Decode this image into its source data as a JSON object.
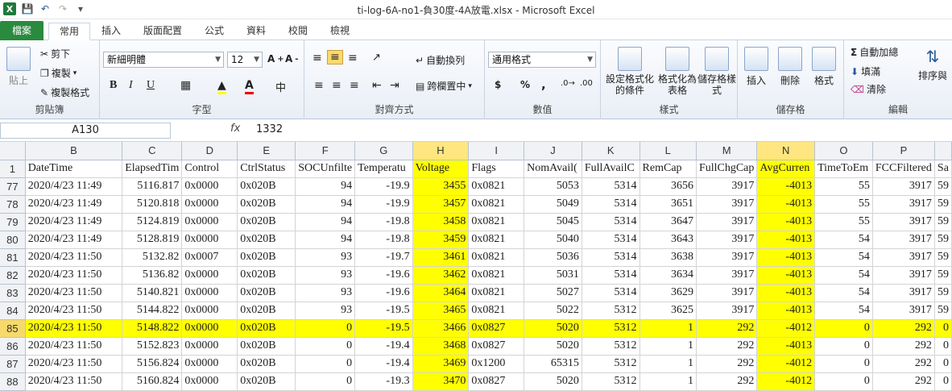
{
  "window": {
    "title": "ti-log-6A-no1-負30度-4A放電.xlsx - Microsoft Excel"
  },
  "tabs": [
    "檔案",
    "常用",
    "插入",
    "版面配置",
    "公式",
    "資料",
    "校閱",
    "檢視"
  ],
  "ribbon": {
    "clipboard": {
      "paste": "貼上",
      "cut": "剪下",
      "copy": "複製",
      "format_painter": "複製格式",
      "label": "剪貼簿"
    },
    "font": {
      "name": "新細明體",
      "size": "12",
      "label": "字型",
      "bold": "B",
      "italic": "I",
      "underline": "U"
    },
    "alignment": {
      "wrap": "自動換列",
      "merge": "跨欄置中",
      "label": "對齊方式"
    },
    "number": {
      "format": "通用格式",
      "label": "數值",
      "currency": "$",
      "percent": "%",
      "comma": ","
    },
    "styles": {
      "conditional": "設定格式化的條件",
      "table": "格式化為表格",
      "cell": "儲存格樣式",
      "label": "樣式"
    },
    "cells": {
      "insert": "插入",
      "delete": "刪除",
      "format": "格式",
      "label": "儲存格"
    },
    "editing": {
      "autosum": "自動加總",
      "fill": "填滿",
      "clear": "清除",
      "sort": "排序與",
      "label": "編輯"
    }
  },
  "formula_bar": {
    "name_box": "A130",
    "fx": "fx",
    "value": "1332"
  },
  "columns": [
    "B",
    "C",
    "D",
    "E",
    "F",
    "G",
    "H",
    "I",
    "J",
    "K",
    "L",
    "M",
    "N",
    "O",
    "P",
    ""
  ],
  "header_row": {
    "row": "1",
    "cells": [
      "DateTime",
      "ElapsedTim",
      "Control",
      "CtrlStatus",
      "SOCUnfilte",
      "Temperatu",
      "Voltage",
      "Flags",
      "NomAvail(",
      "FullAvailC",
      "RemCap",
      "FullChgCap",
      "AvgCurren",
      "TimeToEm",
      "FCCFiltered",
      "Sa"
    ]
  },
  "rows": [
    {
      "row": "77",
      "cells": [
        "2020/4/23 11:49",
        "5116.817",
        "0x0000",
        "0x020B",
        "94",
        "-19.9",
        "3455",
        "0x0821",
        "5053",
        "5314",
        "3656",
        "3917",
        "-4013",
        "55",
        "3917",
        "59"
      ]
    },
    {
      "row": "78",
      "cells": [
        "2020/4/23 11:49",
        "5120.818",
        "0x0000",
        "0x020B",
        "94",
        "-19.9",
        "3457",
        "0x0821",
        "5049",
        "5314",
        "3651",
        "3917",
        "-4013",
        "55",
        "3917",
        "59"
      ]
    },
    {
      "row": "79",
      "cells": [
        "2020/4/23 11:49",
        "5124.819",
        "0x0000",
        "0x020B",
        "94",
        "-19.8",
        "3458",
        "0x0821",
        "5045",
        "5314",
        "3647",
        "3917",
        "-4013",
        "55",
        "3917",
        "59"
      ]
    },
    {
      "row": "80",
      "cells": [
        "2020/4/23 11:49",
        "5128.819",
        "0x0000",
        "0x020B",
        "94",
        "-19.8",
        "3459",
        "0x0821",
        "5040",
        "5314",
        "3643",
        "3917",
        "-4013",
        "54",
        "3917",
        "59"
      ]
    },
    {
      "row": "81",
      "cells": [
        "2020/4/23 11:50",
        "5132.82",
        "0x0007",
        "0x020B",
        "93",
        "-19.7",
        "3461",
        "0x0821",
        "5036",
        "5314",
        "3638",
        "3917",
        "-4013",
        "54",
        "3917",
        "59"
      ]
    },
    {
      "row": "82",
      "cells": [
        "2020/4/23 11:50",
        "5136.82",
        "0x0000",
        "0x020B",
        "93",
        "-19.6",
        "3462",
        "0x0821",
        "5031",
        "5314",
        "3634",
        "3917",
        "-4013",
        "54",
        "3917",
        "59"
      ]
    },
    {
      "row": "83",
      "cells": [
        "2020/4/23 11:50",
        "5140.821",
        "0x0000",
        "0x020B",
        "93",
        "-19.6",
        "3464",
        "0x0821",
        "5027",
        "5314",
        "3629",
        "3917",
        "-4013",
        "54",
        "3917",
        "59"
      ]
    },
    {
      "row": "84",
      "cells": [
        "2020/4/23 11:50",
        "5144.822",
        "0x0000",
        "0x020B",
        "93",
        "-19.5",
        "3465",
        "0x0821",
        "5022",
        "5312",
        "3625",
        "3917",
        "-4013",
        "54",
        "3917",
        "59"
      ]
    },
    {
      "row": "85",
      "highlight": true,
      "cells": [
        "2020/4/23 11:50",
        "5148.822",
        "0x0000",
        "0x020B",
        "0",
        "-19.5",
        "3466",
        "0x0827",
        "5020",
        "5312",
        "1",
        "292",
        "-4012",
        "0",
        "292",
        "0"
      ]
    },
    {
      "row": "86",
      "cells": [
        "2020/4/23 11:50",
        "5152.823",
        "0x0000",
        "0x020B",
        "0",
        "-19.4",
        "3468",
        "0x0827",
        "5020",
        "5312",
        "1",
        "292",
        "-4013",
        "0",
        "292",
        "0"
      ]
    },
    {
      "row": "87",
      "cells": [
        "2020/4/23 11:50",
        "5156.824",
        "0x0000",
        "0x020B",
        "0",
        "-19.4",
        "3469",
        "0x1200",
        "65315",
        "5312",
        "1",
        "292",
        "-4012",
        "0",
        "292",
        "0"
      ]
    },
    {
      "row": "88",
      "cells": [
        "2020/4/23 11:50",
        "5160.824",
        "0x0000",
        "0x020B",
        "0",
        "-19.3",
        "3470",
        "0x0827",
        "5020",
        "5312",
        "1",
        "292",
        "-4012",
        "0",
        "292",
        "0"
      ]
    }
  ],
  "colors": {
    "highlight": "#ffff00",
    "file_tab": "#2a8a3e",
    "header_selected": "#ffe680"
  }
}
